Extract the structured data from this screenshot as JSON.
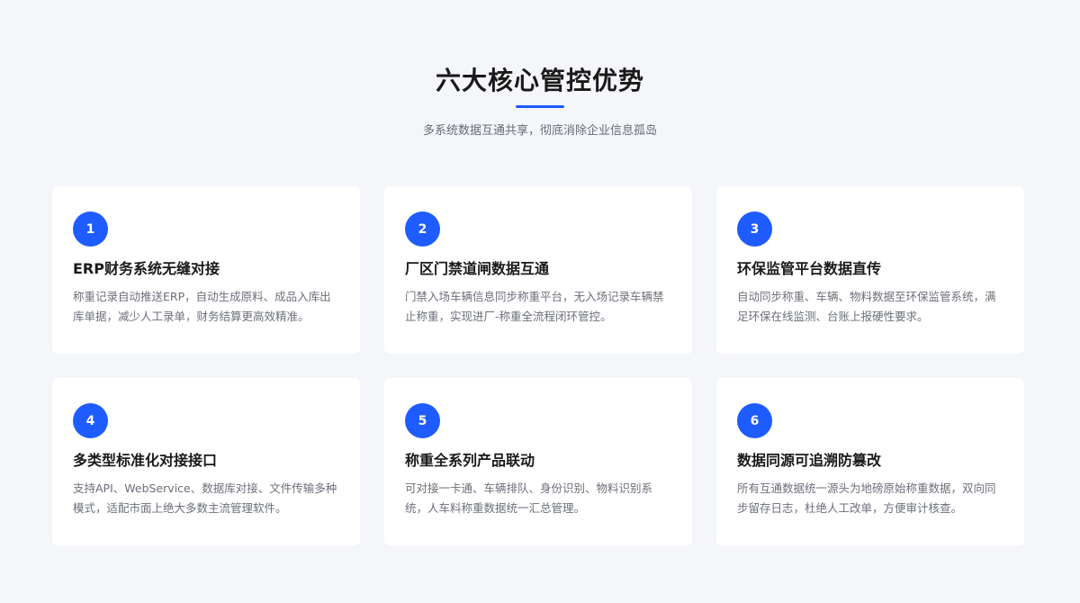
{
  "header": {
    "title": "六大核心管控优势",
    "subtitle": "多系统数据互通共享，彻底消除企业信息孤岛"
  },
  "colors": {
    "accent": "#1f5cff",
    "background": "#f5f6fa",
    "card": "#ffffff"
  },
  "cards": [
    {
      "number": "1",
      "title": "ERP财务系统无缝对接",
      "desc": "称重记录自动推送ERP，自动生成原料、成品入库出库单据，减少人工录单，财务结算更高效精准。"
    },
    {
      "number": "2",
      "title": "厂区门禁道闸数据互通",
      "desc": "门禁入场车辆信息同步称重平台，无入场记录车辆禁止称重，实现进厂-称重全流程闭环管控。"
    },
    {
      "number": "3",
      "title": "环保监管平台数据直传",
      "desc": "自动同步称重、车辆、物料数据至环保监管系统，满足环保在线监测、台账上报硬性要求。"
    },
    {
      "number": "4",
      "title": "多类型标准化对接接口",
      "desc": "支持API、WebService、数据库对接、文件传输多种模式，适配市面上绝大多数主流管理软件。"
    },
    {
      "number": "5",
      "title": "称重全系列产品联动",
      "desc": "可对接一卡通、车辆排队、身份识别、物料识别系统，人车料称重数据统一汇总管理。"
    },
    {
      "number": "6",
      "title": "数据同源可追溯防篡改",
      "desc": "所有互通数据统一源头为地磅原始称重数据，双向同步留存日志，杜绝人工改单，方便审计核查。"
    }
  ]
}
